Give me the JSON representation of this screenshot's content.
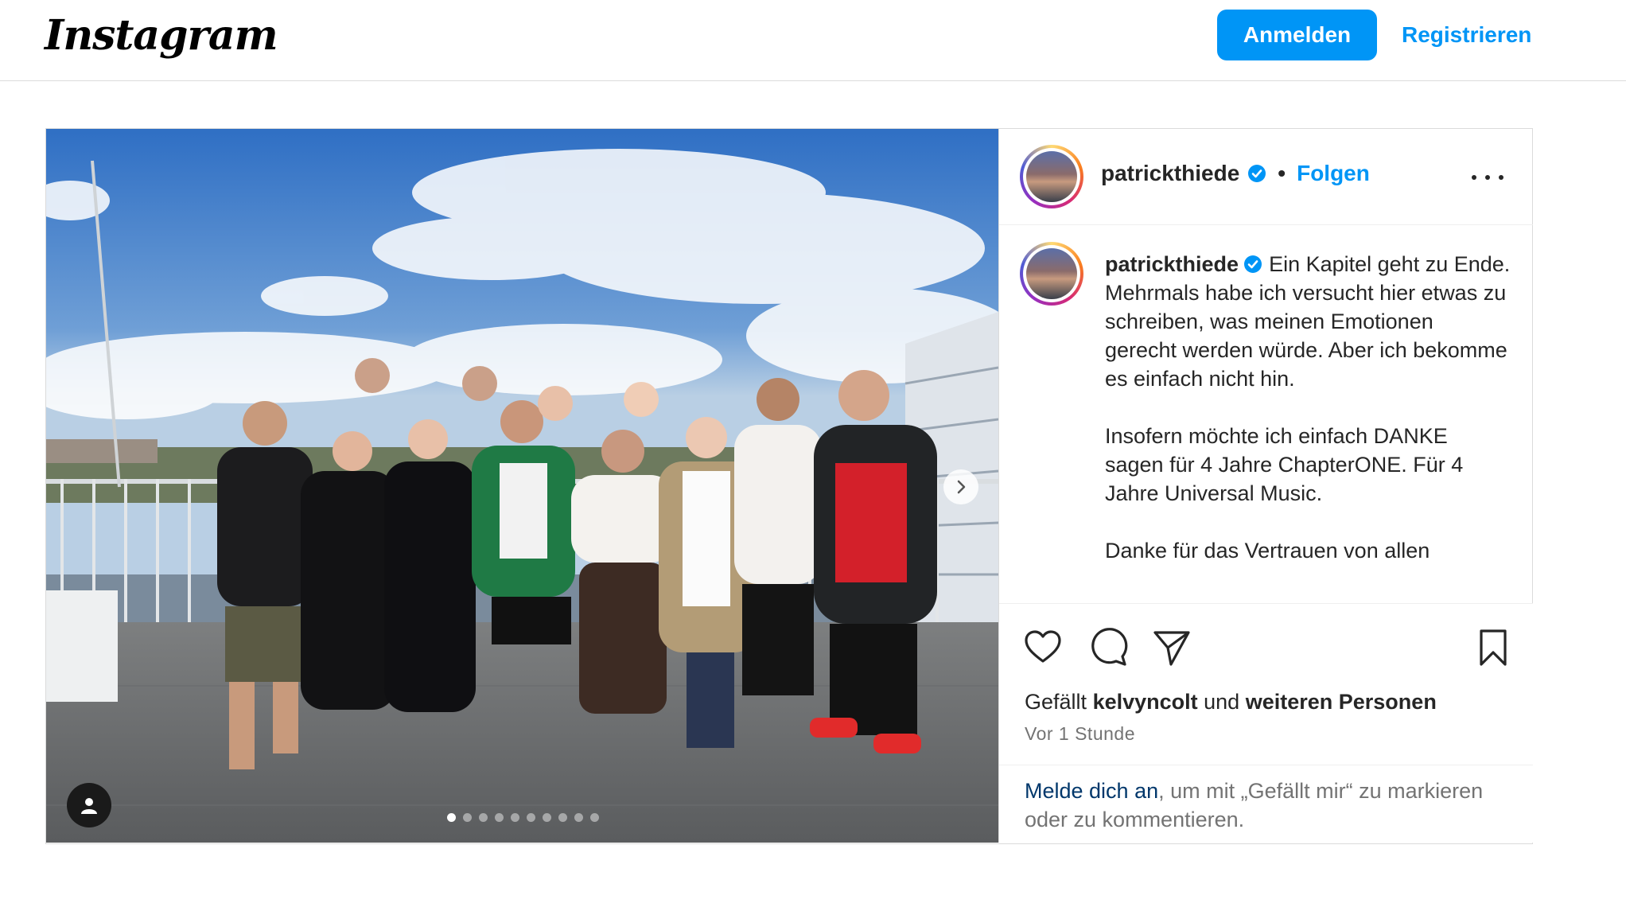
{
  "header": {
    "logo_text": "Instagram",
    "login_label": "Anmelden",
    "register_label": "Registrieren"
  },
  "post": {
    "username": "patrickthiede",
    "separator": "•",
    "follow_label": "Folgen",
    "caption_paragraphs": [
      "Ein Kapitel geht zu Ende. Mehrmals habe ich versucht hier etwas zu schreiben, was meinen Emotionen gerecht werden würde. Aber ich bekomme es einfach nicht hin.",
      "Insofern möchte ich einfach DANKE sagen für 4 Jahre ChapterONE. Für 4 Jahre Universal Music.",
      "Danke für das Vertrauen von allen"
    ],
    "likes_prefix": "Gefällt",
    "likes_user": "kelvyncolt",
    "likes_middle": "und",
    "likes_suffix": "weiteren Personen",
    "time": "Vor 1 Stunde",
    "login_link": "Melde dich an",
    "login_rest": ", um mit „Gefällt mir“ zu markieren oder zu kommentieren.",
    "carousel_count": 10,
    "carousel_active": 0,
    "icons": {
      "like": "heart-icon",
      "comment": "comment-icon",
      "share": "share-icon",
      "save": "bookmark-icon",
      "more": "more-icon",
      "next": "chevron-right-icon",
      "tag": "user-tag-icon"
    },
    "colors": {
      "accent": "#0095f6",
      "link_dark": "#00376b",
      "muted": "#737373"
    }
  }
}
